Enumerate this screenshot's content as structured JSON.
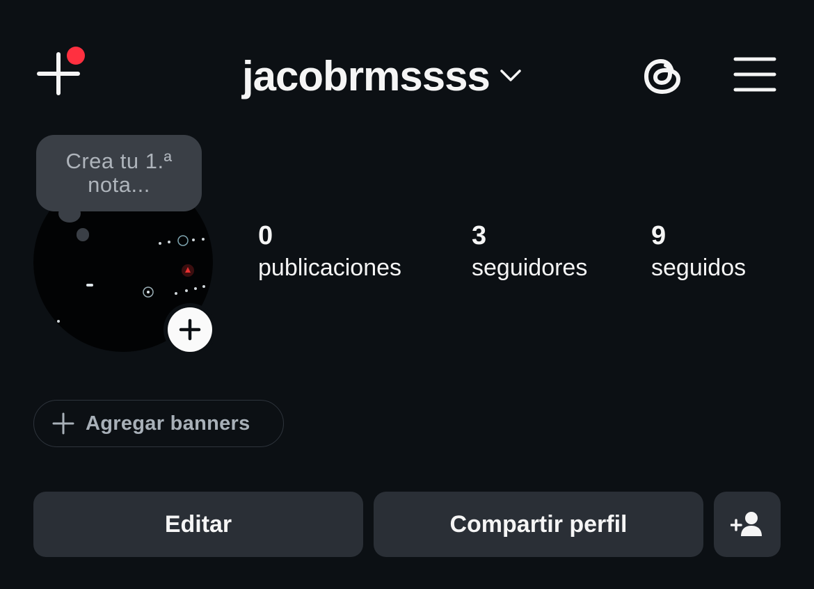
{
  "header": {
    "username": "jacobrmssss",
    "icons": {
      "new_post": "plus-icon",
      "notification": "notification-dot",
      "dropdown": "chevron-down-icon",
      "threads": "threads-icon",
      "menu": "hamburger-menu-icon"
    },
    "notification_color": "#ff3040"
  },
  "profile": {
    "note_prompt": "Crea tu 1.ª nota...",
    "avatar_add_icon": "plus-icon"
  },
  "stats": [
    {
      "value": "0",
      "label": "publicaciones"
    },
    {
      "value": "3",
      "label": "seguidores"
    },
    {
      "value": "9",
      "label": "seguidos"
    }
  ],
  "banner_button": {
    "label": "Agregar banners",
    "icon": "plus-icon"
  },
  "actions": {
    "edit_label": "Editar",
    "share_label": "Compartir perfil",
    "suggest_icon": "add-person-icon"
  },
  "colors": {
    "background": "#0c1014",
    "button_bg": "#2a2f36",
    "note_bg": "#3a3f46"
  }
}
